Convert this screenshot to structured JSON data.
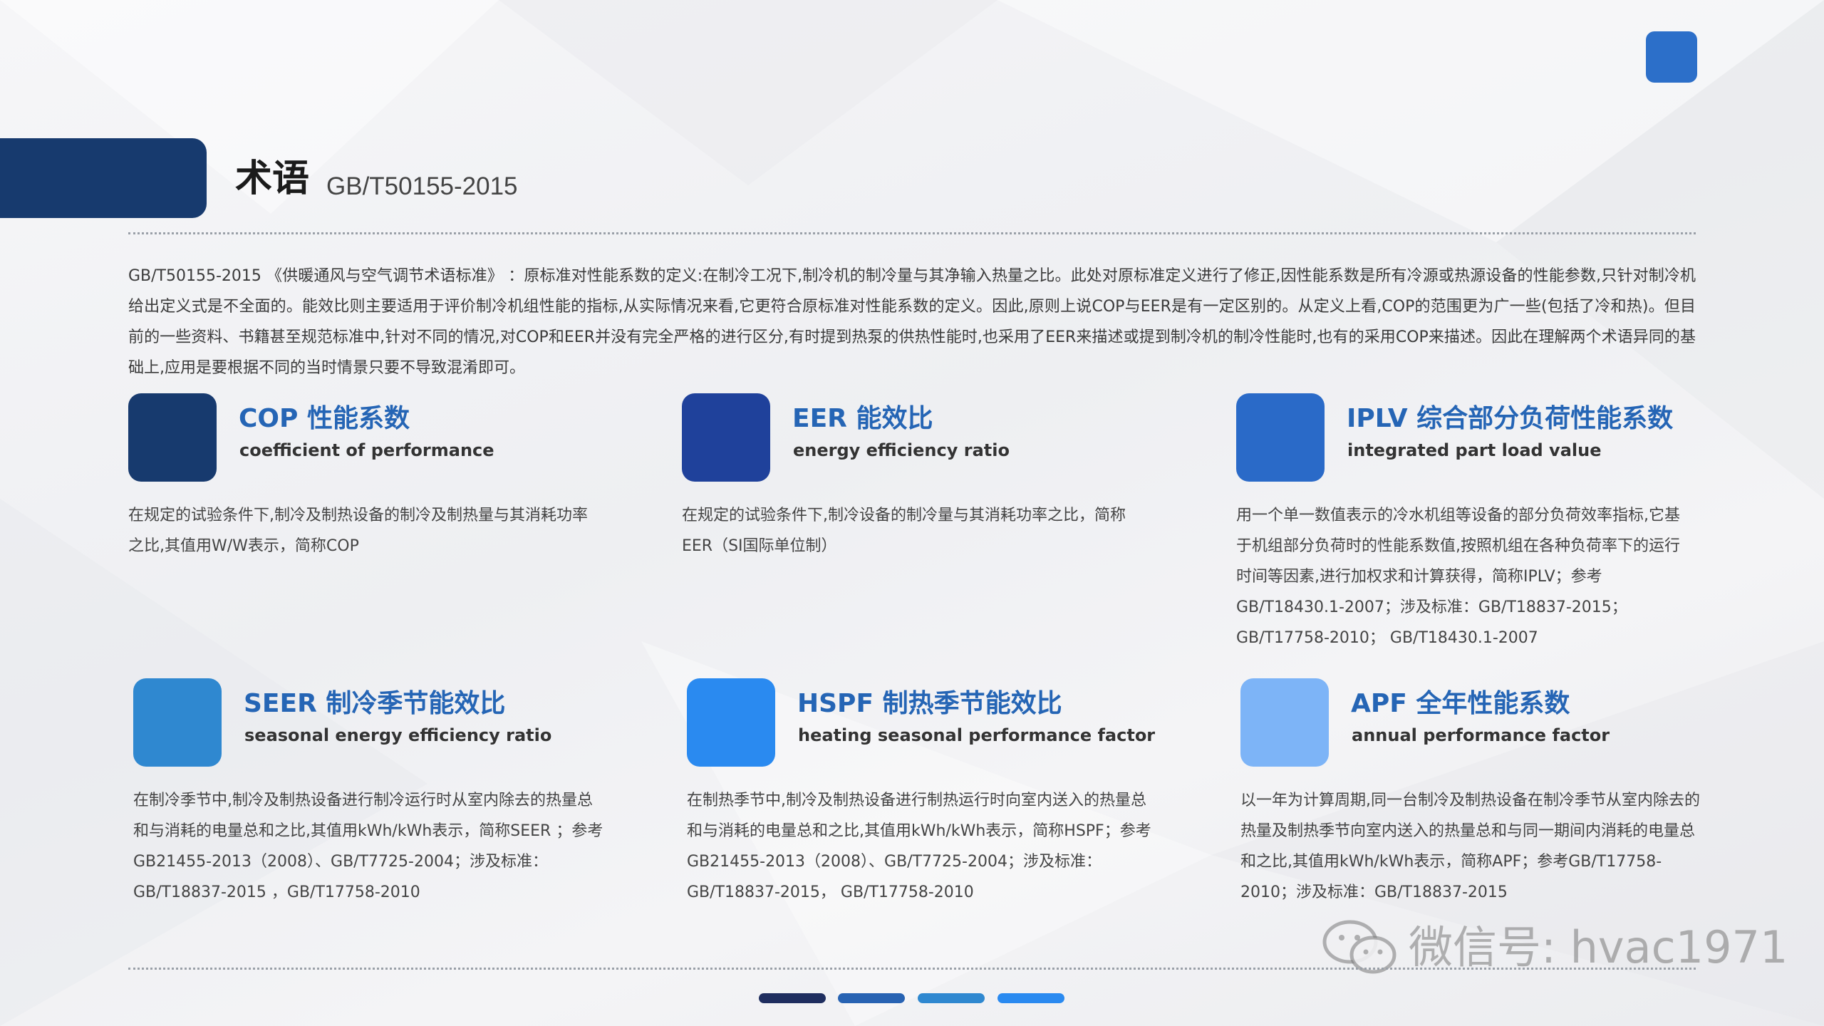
{
  "colors": {
    "title_bar": "#173a6e",
    "corner_square": "#2c6fc9",
    "heading_text": "#2565b5",
    "squares": [
      "#173a6e",
      "#1f419b",
      "#2a6ac8",
      "#2f88d0",
      "#2a8af0",
      "#7db4f7"
    ],
    "pager": [
      "#1f2e5f",
      "#2863b3",
      "#2f88d0",
      "#2a8af0"
    ]
  },
  "header": {
    "title": "术语",
    "subtitle": "GB/T50155-2015"
  },
  "intro": "GB/T50155-2015 《供暖通风与空气调节术语标准》 ：原标准对性能系数的定义:在制冷工况下,制冷机的制冷量与其净输入热量之比。此处对原标准定义进行了修正,因性能系数是所有冷源或热源设备的性能参数,只针对制冷机给出定义式是不全面的。能效比则主要适用于评价制冷机组性能的指标,从实际情况来看,它更符合原标准对性能系数的定义。因此,原则上说COP与EER是有一定区别的。从定义上看,COP的范围更为广一些(包括了冷和热)。但目前的一些资料、书籍甚至规范标准中,针对不同的情况,对COP和EER并没有完全严格的进行区分,有时提到热泵的供热性能时,也采用了EER来描述或提到制冷机的制冷性能时,也有的采用COP来描述。因此在理解两个术语异同的基础上,应用是要根据不同的当时情景只要不导致混淆即可。",
  "cards": [
    {
      "title": "COP 性能系数",
      "subtitle": "coefficient of performance",
      "body": "在规定的试验条件下,制冷及制热设备的制冷及制热量与其消耗功率之比,其值用W/W表示，简称COP"
    },
    {
      "title": "EER 能效比",
      "subtitle": "energy efficiency ratio",
      "body": "在规定的试验条件下,制冷设备的制冷量与其消耗功率之比，简称EER（SI国际单位制）"
    },
    {
      "title": "IPLV 综合部分负荷性能系数",
      "subtitle": "integrated part load value",
      "body": "用一个单一数值表示的冷水机组等设备的部分负荷效率指标,它基于机组部分负荷时的性能系数值,按照机组在各种负荷率下的运行时间等因素,进行加权求和计算获得，简称IPLV；参考GB/T18430.1-2007；涉及标准：GB/T18837-2015；GB/T17758-2010； GB/T18430.1-2007"
    },
    {
      "title": "SEER 制冷季节能效比",
      "subtitle": "seasonal energy efficiency ratio",
      "body": "在制冷季节中,制冷及制热设备进行制冷运行时从室内除去的热量总和与消耗的电量总和之比,其值用kWh/kWh表示，简称SEER ；参考GB21455-2013（2008）、GB/T7725-2004；涉及标准：GB/T18837-2015 ，GB/T17758-2010"
    },
    {
      "title": "HSPF 制热季节能效比",
      "subtitle": "heating seasonal performance factor",
      "body": "在制热季节中,制冷及制热设备进行制热运行时向室内送入的热量总和与消耗的电量总和之比,其值用kWh/kWh表示，简称HSPF；参考GB21455-2013（2008）、GB/T7725-2004；涉及标准：GB/T18837-2015， GB/T17758-2010"
    },
    {
      "title": "APF 全年性能系数",
      "subtitle": "annual performance factor",
      "body": "以一年为计算周期,同一台制冷及制热设备在制冷季节从室内除去的热量及制热季节向室内送入的热量总和与同一期间内消耗的电量总和之比,其值用kWh/kWh表示，简称APF；参考GB/T17758-2010；涉及标准：GB/T18837-2015"
    }
  ],
  "watermark": "微信号: hvac1971"
}
